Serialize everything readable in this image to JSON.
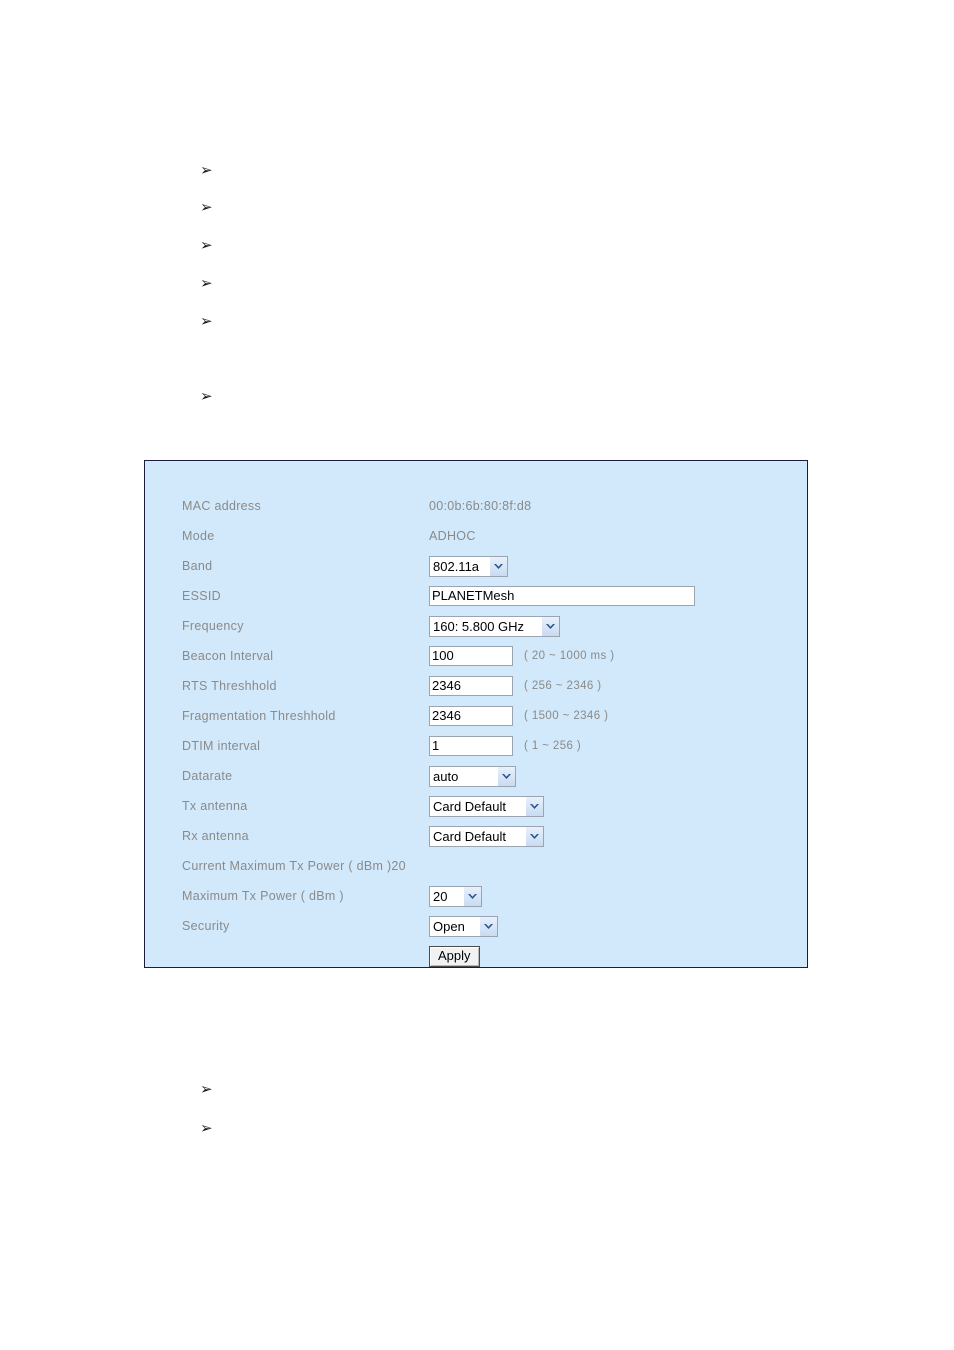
{
  "page": {
    "background": "#ffffff",
    "bullet_glyph": "➢"
  },
  "bullets_top": [
    {
      "text": ""
    },
    {
      "text": ""
    },
    {
      "text": ""
    },
    {
      "text": ""
    },
    {
      "text": ""
    },
    {
      "text": ""
    }
  ],
  "bullets_bottom": [
    {
      "text": ""
    },
    {
      "text": ""
    }
  ],
  "panel": {
    "background": "#d2e9fb",
    "border_color": "#1c1c3c",
    "label_color": "#8a8a8a",
    "accent_color": "#3a6ea5",
    "rows": [
      {
        "label": "MAC address",
        "type": "static",
        "value": "00:0b:6b:80:8f:d8"
      },
      {
        "label": "Mode",
        "type": "static",
        "value": "ADHOC"
      },
      {
        "label": "Band",
        "type": "select",
        "variant": "band",
        "value": "802.11a"
      },
      {
        "label": "ESSID",
        "type": "text",
        "variant": "essid",
        "value": "PLANETMesh",
        "placeholder": ""
      },
      {
        "label": "Frequency",
        "type": "select",
        "variant": "freq",
        "value": "160: 5.800 GHz"
      },
      {
        "label": "Beacon Interval",
        "type": "text",
        "variant": "num",
        "value": "100",
        "placeholder": "",
        "hint": "( 20 ~ 1000 ms )"
      },
      {
        "label": "RTS Threshhold",
        "type": "text",
        "variant": "num",
        "value": "2346",
        "placeholder": "",
        "hint": "( 256 ~ 2346 )"
      },
      {
        "label": "Fragmentation Threshhold",
        "type": "text",
        "variant": "num",
        "value": "2346",
        "placeholder": "",
        "hint": "( 1500 ~ 2346 )"
      },
      {
        "label": "DTIM interval",
        "type": "text",
        "variant": "num",
        "value": "1",
        "placeholder": "",
        "hint": "( 1 ~ 256 )"
      },
      {
        "label": "Datarate",
        "type": "select",
        "variant": "datarate",
        "value": "auto"
      },
      {
        "label": "Tx antenna",
        "type": "select",
        "variant": "antenna",
        "value": "Card Default"
      },
      {
        "label": "Rx antenna",
        "type": "select",
        "variant": "antenna",
        "value": "Card Default"
      },
      {
        "label": "Current Maximum Tx Power ( dBm )",
        "type": "inline",
        "value": "20"
      },
      {
        "label": "Maximum Tx Power ( dBm )",
        "type": "select",
        "variant": "txpower",
        "value": "20"
      },
      {
        "label": "Security",
        "type": "select",
        "variant": "security",
        "value": "Open"
      }
    ],
    "apply_label": "Apply"
  }
}
